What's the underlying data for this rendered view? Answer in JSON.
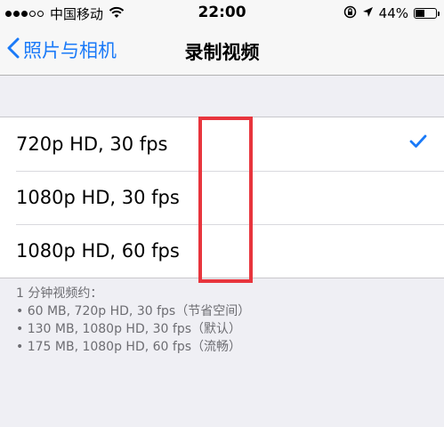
{
  "status_bar": {
    "carrier": "中国移动",
    "time": "22:00",
    "battery": "44%",
    "battery_level": 0.44,
    "signal_bars": 3,
    "icons": [
      "signal-icon",
      "wifi-icon",
      "orientation-lock-icon",
      "location-icon",
      "battery-icon"
    ]
  },
  "nav": {
    "back_label": "照片与相机",
    "title": "录制视频"
  },
  "options": [
    {
      "label": "720p HD, 30 fps",
      "selected": true
    },
    {
      "label": "1080p HD, 30 fps",
      "selected": false
    },
    {
      "label": "1080p HD, 60 fps",
      "selected": false
    }
  ],
  "footer": {
    "heading": "1 分钟视频约：",
    "lines": [
      "• 60 MB, 720p HD, 30 fps（节省空间）",
      "• 130 MB, 1080p HD, 30 fps（默认）",
      "• 175 MB, 1080p HD, 60 fps（流畅）"
    ]
  },
  "colors": {
    "accent": "#1a7af8",
    "highlight": "#e8353d",
    "background": "#efeff4"
  }
}
